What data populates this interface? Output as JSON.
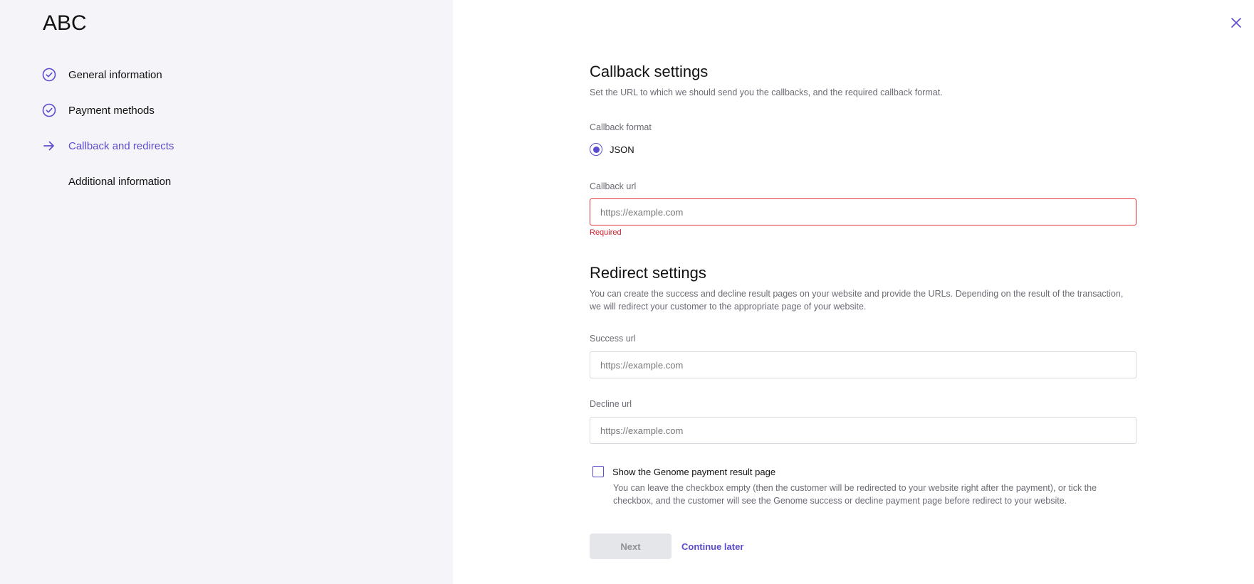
{
  "sidebar": {
    "brand": "ABC",
    "steps": [
      {
        "label": "General information",
        "state": "done",
        "icon": "check-circle-icon"
      },
      {
        "label": "Payment methods",
        "state": "done",
        "icon": "check-circle-icon"
      },
      {
        "label": "Callback and redirects",
        "state": "active",
        "icon": "arrow-right-icon"
      },
      {
        "label": "Additional information",
        "state": "pending",
        "icon": ""
      }
    ]
  },
  "callback": {
    "title": "Callback settings",
    "description": "Set the URL to which we should send you the callbacks, and the required callback format.",
    "format_label": "Callback format",
    "format_option": "JSON",
    "format_selected": true,
    "url_label": "Callback url",
    "url_placeholder": "https://example.com",
    "url_value": "",
    "url_error": "Required"
  },
  "redirect": {
    "title": "Redirect settings",
    "description": "You can create the success and decline result pages on your website and provide the URLs. Depending on the result of the transaction, we will redirect your customer to the appropriate page of your website.",
    "success_label": "Success url",
    "success_placeholder": "https://example.com",
    "decline_label": "Decline url",
    "decline_placeholder": "https://example.com",
    "checkbox_label": "Show the Genome payment result page",
    "checkbox_checked": false,
    "checkbox_help": "You can leave the checkbox empty (then the customer will be redirected to your website right after the payment), or tick the checkbox, and the customer will see the Genome success or decline payment page before redirect to your website."
  },
  "actions": {
    "next_label": "Next",
    "next_disabled": true,
    "later_label": "Continue later"
  },
  "colors": {
    "accent": "#5b4ccf",
    "error": "#e0353a",
    "sidebar_bg": "#f5f5f9"
  }
}
